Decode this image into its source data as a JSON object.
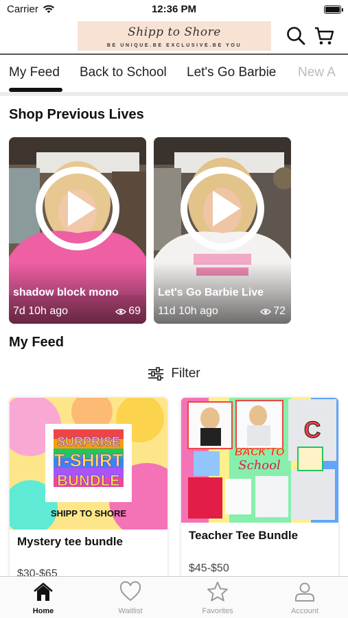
{
  "status_bar": {
    "carrier": "Carrier",
    "time": "12:36 PM"
  },
  "header": {
    "logo_script": "Shipp to Shore",
    "logo_tagline": "BE UNIQUE.BE EXCLUSIVE.BE YOU"
  },
  "tabs": [
    {
      "label": "My Feed"
    },
    {
      "label": "Back to School"
    },
    {
      "label": "Let's Go Barbie"
    },
    {
      "label": "New A"
    }
  ],
  "sections": {
    "previous_lives": "Shop Previous Lives",
    "my_feed": "My Feed"
  },
  "lives": [
    {
      "title": "shadow block mono",
      "ago": "7d 10h ago",
      "views": "69"
    },
    {
      "title": "Let's Go Barbie Live",
      "ago": "11d 10h ago",
      "views": "72"
    }
  ],
  "filter": {
    "label": "Filter"
  },
  "products": [
    {
      "name": "Mystery tee bundle",
      "price": "$30-$65",
      "art_line1": "SURPRISE",
      "art_line2": "T-SHIRT",
      "art_line3": "BUNDLE",
      "art_brand": "SHIPP TO SHORE"
    },
    {
      "name": "Teacher Tee Bundle",
      "price": "$45-$50",
      "art_line1": "BACK TO",
      "art_line2": "School"
    }
  ],
  "tabbar": [
    {
      "label": "Home"
    },
    {
      "label": "Waitlist"
    },
    {
      "label": "Favorites"
    },
    {
      "label": "Account"
    }
  ],
  "colors": {
    "accent": "#111111",
    "inactive": "#999999",
    "logo_bg": "#f7e2d4"
  }
}
